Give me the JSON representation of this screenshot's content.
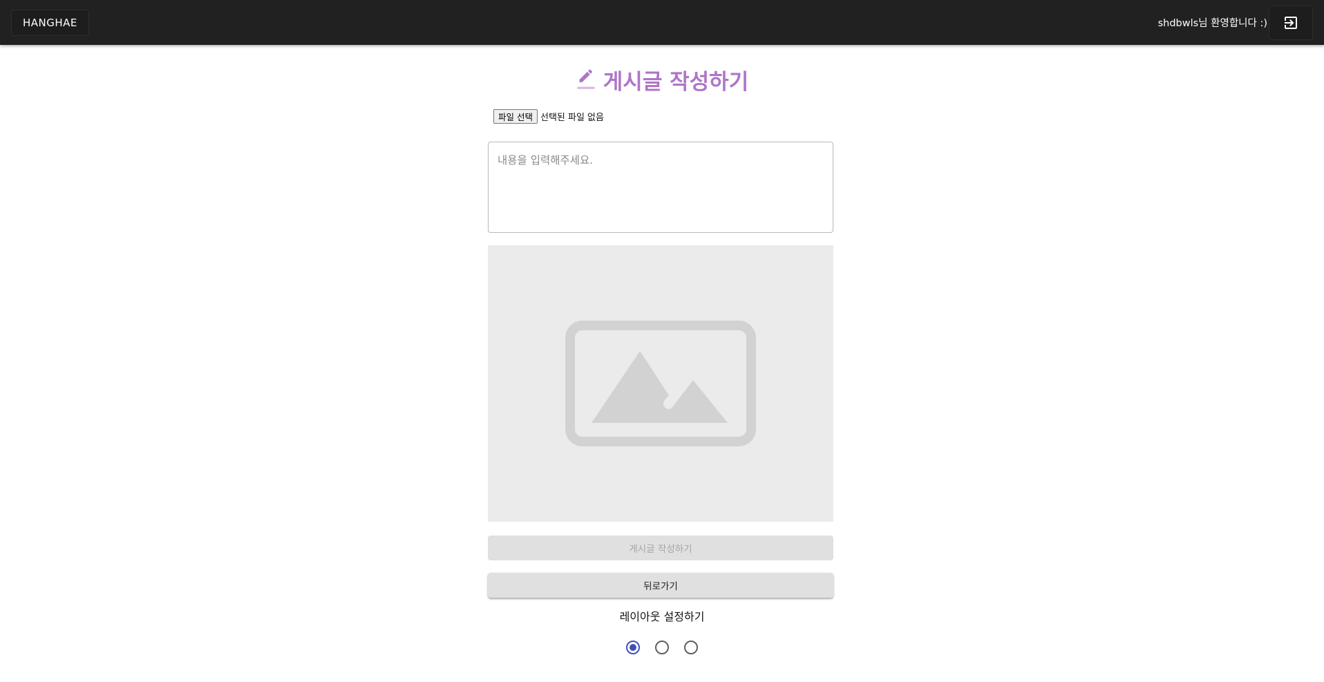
{
  "header": {
    "brand_label": "HANGHAE",
    "welcome_text": "shdbwls님 환영합니다 :)",
    "logout_icon": "logout-icon"
  },
  "page": {
    "title": "게시글 작성하기",
    "title_icon": "pencil-icon",
    "title_color": "#ae75c9"
  },
  "file_input": {
    "button_label": "파일 선택",
    "status_text": "선택된 파일 없음"
  },
  "content": {
    "placeholder": "내용을 입력해주세요.",
    "value": ""
  },
  "preview": {
    "icon": "image-placeholder-icon"
  },
  "actions": {
    "submit_label": "게시글 작성하기",
    "back_label": "뒤로가기"
  },
  "layout": {
    "label": "레이아웃 설정하기",
    "options": [
      {
        "selected": true
      },
      {
        "selected": false
      },
      {
        "selected": false
      }
    ],
    "accent_color": "#3f51b5"
  }
}
